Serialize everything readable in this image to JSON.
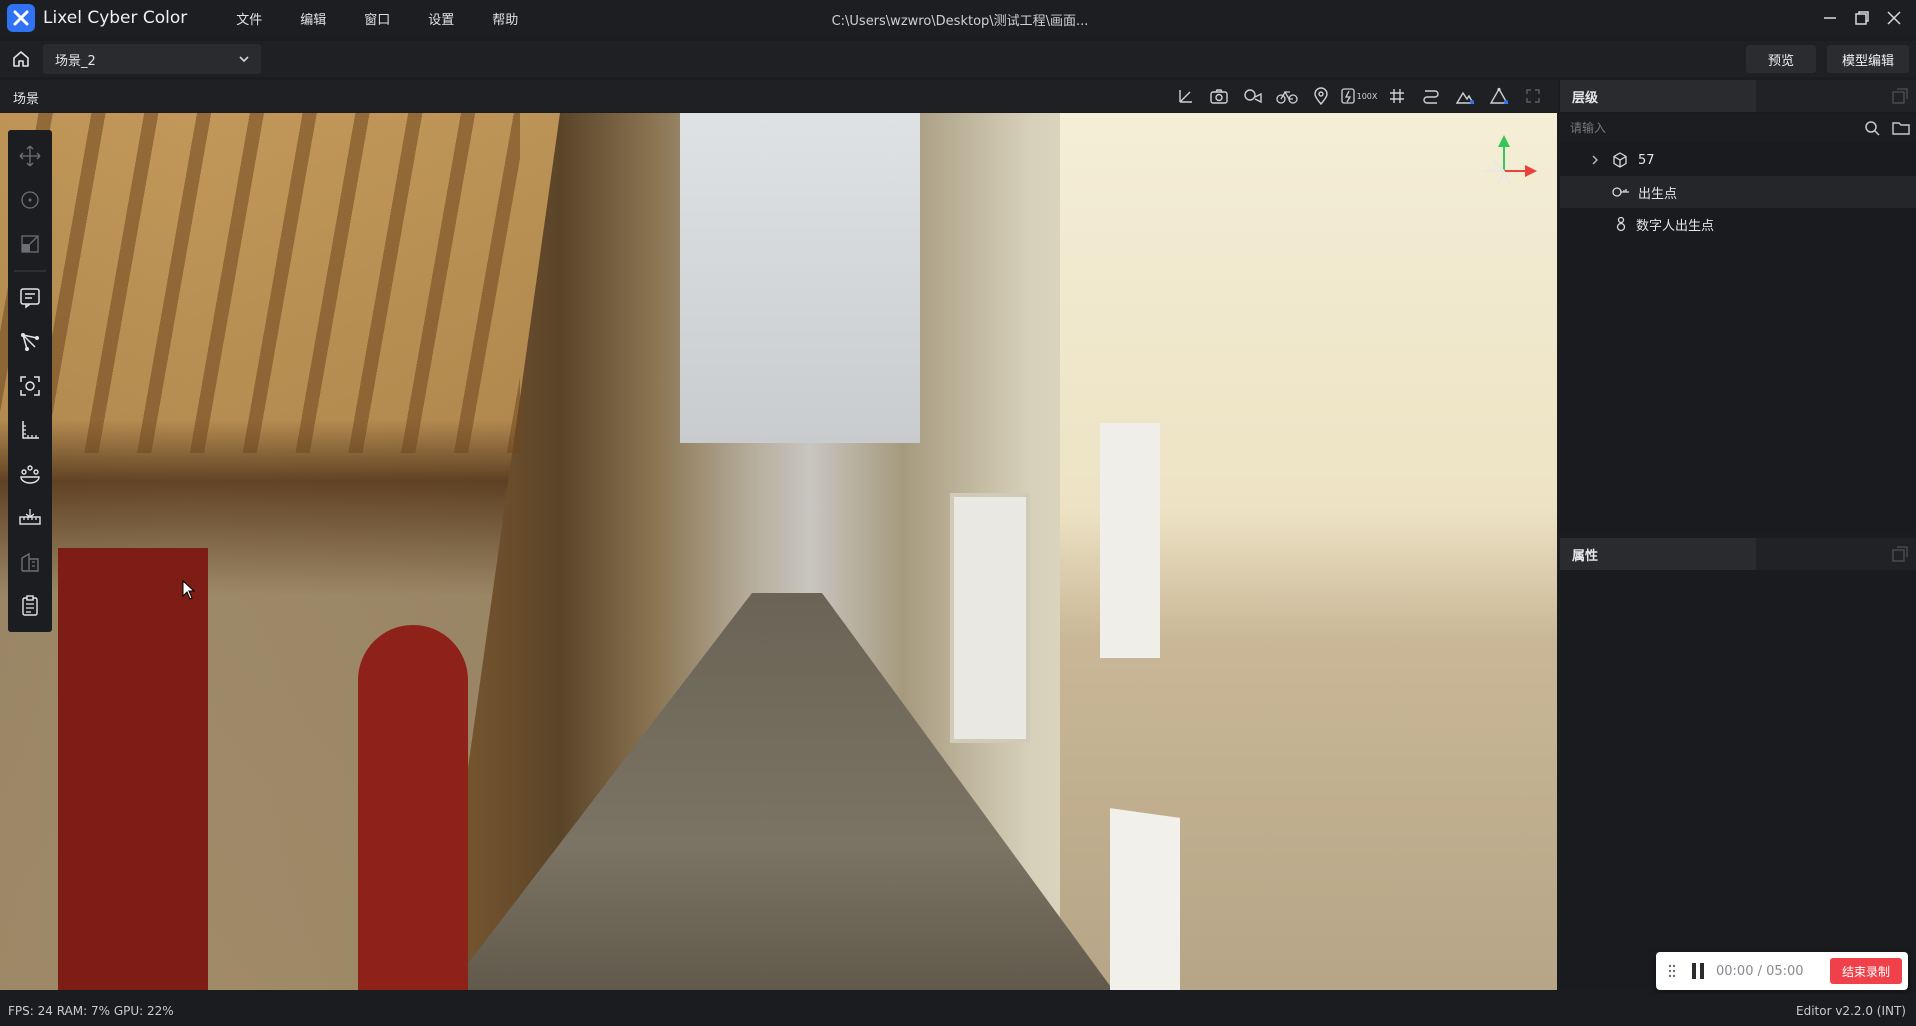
{
  "app": {
    "name": "Lixel Cyber Color",
    "file_path": "C:\\Users\\wzwro\\Desktop\\测试工程\\画面...",
    "menus": [
      "文件",
      "编辑",
      "窗口",
      "设置",
      "帮助"
    ]
  },
  "toolbar": {
    "scene_name": "场景_2",
    "preview_label": "预览",
    "model_edit_label": "模型编辑"
  },
  "scene_panel": {
    "title": "场景",
    "view_tools": [
      "axis-icon",
      "camera-icon",
      "video-camera-icon",
      "bike-icon",
      "location-pin-icon",
      "speed-100x-icon",
      "grid-icon",
      "route-icon",
      "terrain-icon",
      "triangle-icon",
      "fullscreen-icon"
    ],
    "speed_label": "100X",
    "left_tools": [
      "move-icon",
      "rotate-icon",
      "scale-icon",
      "annotation-icon",
      "polyline-icon",
      "focus-icon",
      "measure-angle-icon",
      "crowd-icon",
      "ruler-icon",
      "building-icon",
      "clipboard-icon"
    ]
  },
  "hierarchy": {
    "title": "层级",
    "search_placeholder": "请输入",
    "items": [
      {
        "label": "57",
        "icon": "cube-icon"
      },
      {
        "label": "出生点",
        "icon": "spawn-icon"
      },
      {
        "label": "数字人出生点",
        "icon": "person-icon"
      }
    ]
  },
  "properties": {
    "title": "属性"
  },
  "recording": {
    "time": "00:00 / 05:00",
    "stop_label": "结束录制"
  },
  "status": {
    "stats": "FPS: 24  RAM: 7%  GPU: 22%",
    "version": "Editor v2.2.0 (INT)"
  },
  "colors": {
    "accent": "#2f72f4",
    "record_red": "#f0414a",
    "gizmo_green": "#35c759",
    "gizmo_red": "#e8423a"
  }
}
